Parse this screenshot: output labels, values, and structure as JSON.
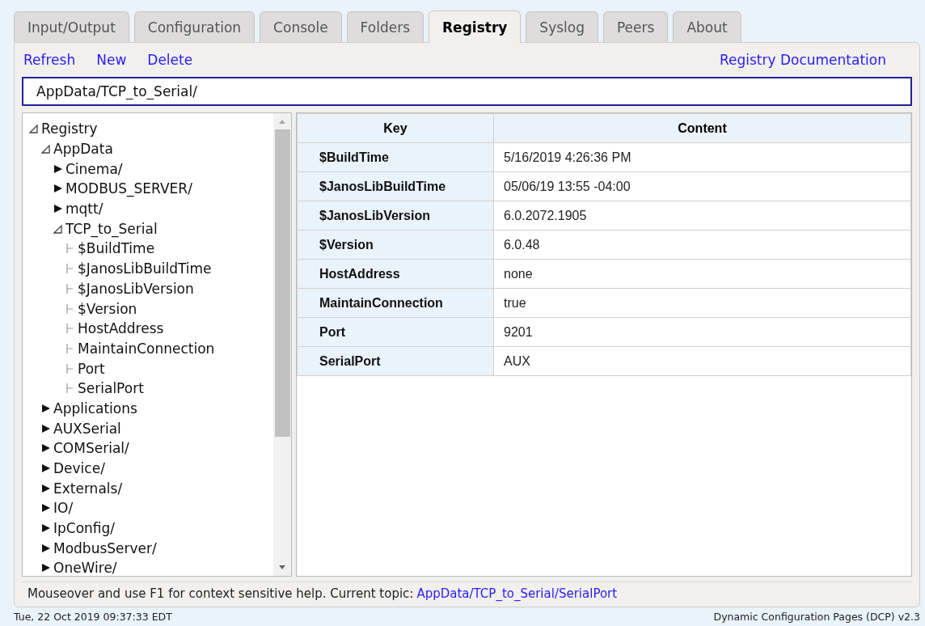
{
  "tabs": [
    {
      "label": "Input/Output",
      "selected": false
    },
    {
      "label": "Configuration",
      "selected": false
    },
    {
      "label": "Console",
      "selected": false
    },
    {
      "label": "Folders",
      "selected": false
    },
    {
      "label": "Registry",
      "selected": true
    },
    {
      "label": "Syslog",
      "selected": false
    },
    {
      "label": "Peers",
      "selected": false
    },
    {
      "label": "About",
      "selected": false
    }
  ],
  "toolbar": {
    "actions": [
      "Refresh",
      "New",
      "Delete"
    ],
    "documentation_link": "Registry Documentation"
  },
  "path_field": {
    "value": "AppData/TCP_to_Serial/"
  },
  "tree": [
    {
      "label": "Registry",
      "expanded": true,
      "children": [
        {
          "label": "AppData",
          "expanded": true,
          "children": [
            {
              "label": "Cinema/",
              "expanded": false
            },
            {
              "label": "MODBUS_SERVER/",
              "expanded": false
            },
            {
              "label": "mqtt/",
              "expanded": false
            },
            {
              "label": "TCP_to_Serial",
              "expanded": true,
              "children": [
                {
                  "label": "$BuildTime",
                  "kind": "leaf"
                },
                {
                  "label": "$JanosLibBuildTime",
                  "kind": "leaf"
                },
                {
                  "label": "$JanosLibVersion",
                  "kind": "leaf"
                },
                {
                  "label": "$Version",
                  "kind": "leaf"
                },
                {
                  "label": "HostAddress",
                  "kind": "leaf"
                },
                {
                  "label": "MaintainConnection",
                  "kind": "leaf"
                },
                {
                  "label": "Port",
                  "kind": "leaf"
                },
                {
                  "label": "SerialPort",
                  "kind": "leaf"
                }
              ]
            }
          ]
        },
        {
          "label": "Applications",
          "expanded": false
        },
        {
          "label": "AUXSerial",
          "expanded": false
        },
        {
          "label": "COMSerial/",
          "expanded": false
        },
        {
          "label": "Device/",
          "expanded": false
        },
        {
          "label": "Externals/",
          "expanded": false
        },
        {
          "label": "IO/",
          "expanded": false
        },
        {
          "label": "IpConfig/",
          "expanded": false
        },
        {
          "label": "ModbusServer/",
          "expanded": false
        },
        {
          "label": "OneWire/",
          "expanded": false
        }
      ]
    }
  ],
  "table": {
    "columns": [
      "Key",
      "Content"
    ],
    "rows": [
      [
        "$BuildTime",
        "5/16/2019 4:26:36 PM"
      ],
      [
        "$JanosLibBuildTime",
        "05/06/19 13:55 -04:00"
      ],
      [
        "$JanosLibVersion",
        "6.0.2072.1905"
      ],
      [
        "$Version",
        "6.0.48"
      ],
      [
        "HostAddress",
        "none"
      ],
      [
        "MaintainConnection",
        "true"
      ],
      [
        "Port",
        "9201"
      ],
      [
        "SerialPort",
        "AUX"
      ]
    ]
  },
  "help_bar": {
    "text": "Mouseover and use F1 for context sensitive help. Current topic:",
    "topic": "AppData/TCP_to_Serial/SerialPort"
  },
  "status_bar": {
    "datetime": "Tue, 22 Oct 2019 09:37:33 EDT",
    "version": "Dynamic Configuration Pages (DCP) v2.3"
  }
}
